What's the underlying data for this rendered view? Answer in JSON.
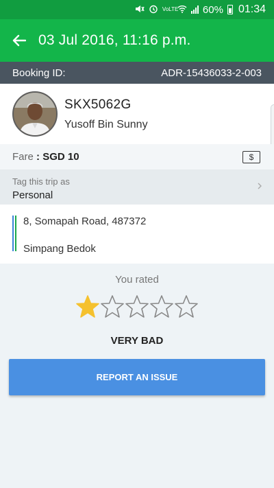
{
  "status_bar": {
    "battery": "60%",
    "time": "01:34",
    "network": "VoLTE",
    "icons": [
      "mute-icon",
      "alarm-icon",
      "volte-icon",
      "wifi-icon",
      "signal-icon",
      "battery-icon"
    ]
  },
  "header": {
    "title": "03 Jul 2016, 11:16 p.m.",
    "back_icon": "arrow-left-icon"
  },
  "booking": {
    "label": "Booking ID:",
    "id": "ADR-15436033-2-003"
  },
  "driver": {
    "plate": "SKX5062G",
    "name": "Yusoff Bin Sunny"
  },
  "fare": {
    "label": "Fare",
    "separator": " : ",
    "value": "SGD 10",
    "payment_icon": "$"
  },
  "tag": {
    "label": "Tag this trip as",
    "value": "Personal"
  },
  "route": {
    "pickup": "8, Somapah Road, 487372",
    "dropoff": "Simpang Bedok"
  },
  "rating": {
    "label": "You rated",
    "stars_filled": 1,
    "stars_total": 5,
    "text": "VERY BAD",
    "filled_color": "#f5c12e",
    "empty_color": "#888888"
  },
  "action": {
    "report_label": "REPORT AN ISSUE",
    "color": "#4a90e2"
  },
  "colors": {
    "status_bar": "#119d40",
    "app_bar": "#13b54a",
    "booking_bar": "#4a5560"
  }
}
